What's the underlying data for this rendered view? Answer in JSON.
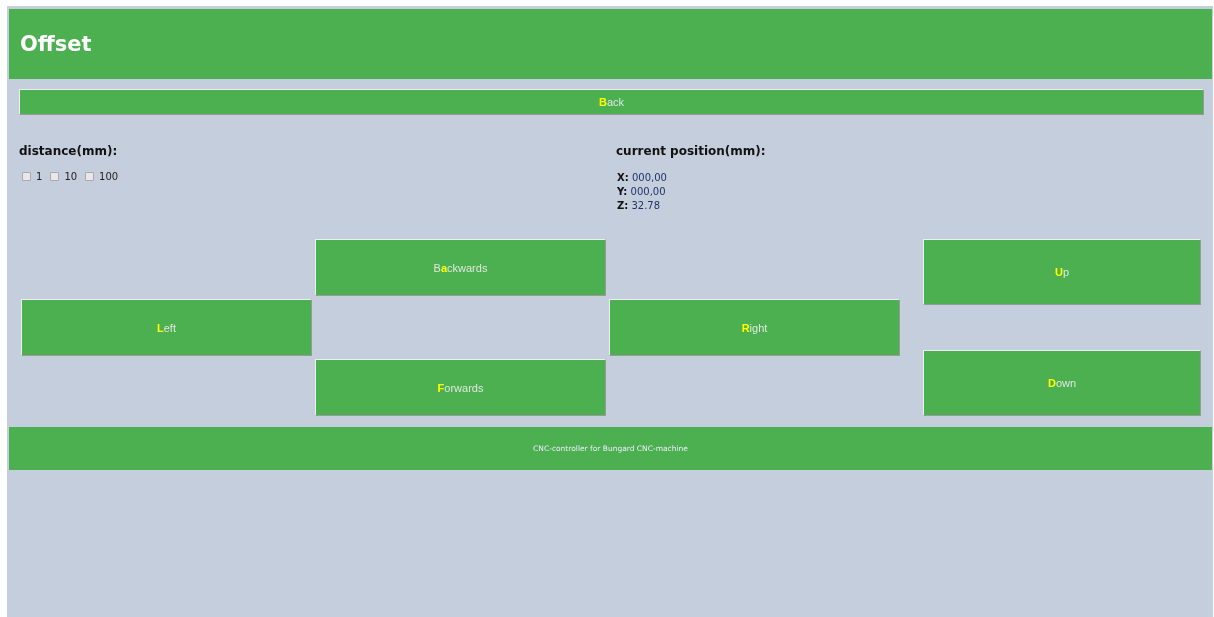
{
  "header": {
    "title": "Offset"
  },
  "back_button": {
    "label": "**B**ack"
  },
  "distance": {
    "title": "distance(mm):",
    "options": [
      {
        "label": "1",
        "checked": false
      },
      {
        "label": "10",
        "checked": false
      },
      {
        "label": "100",
        "checked": false
      }
    ]
  },
  "position": {
    "title": "current position(mm):",
    "axes": [
      {
        "axis": "X:",
        "value": "000,00"
      },
      {
        "axis": "Y:",
        "value": "000,00"
      },
      {
        "axis": "Z:",
        "value": "32.78"
      }
    ]
  },
  "move_buttons": [
    {
      "kind": "backwards",
      "label": "B**a**ckwards"
    },
    {
      "kind": "left",
      "label": "**L**eft"
    },
    {
      "kind": "right",
      "label": "**R**ight"
    },
    {
      "kind": "forwards",
      "label": "**F**orwards"
    },
    {
      "kind": "up",
      "label": "**U**p"
    },
    {
      "kind": "down",
      "label": "**D**own"
    }
  ],
  "footer": {
    "text": "CNC-controller for Bungard CNC-machine"
  }
}
